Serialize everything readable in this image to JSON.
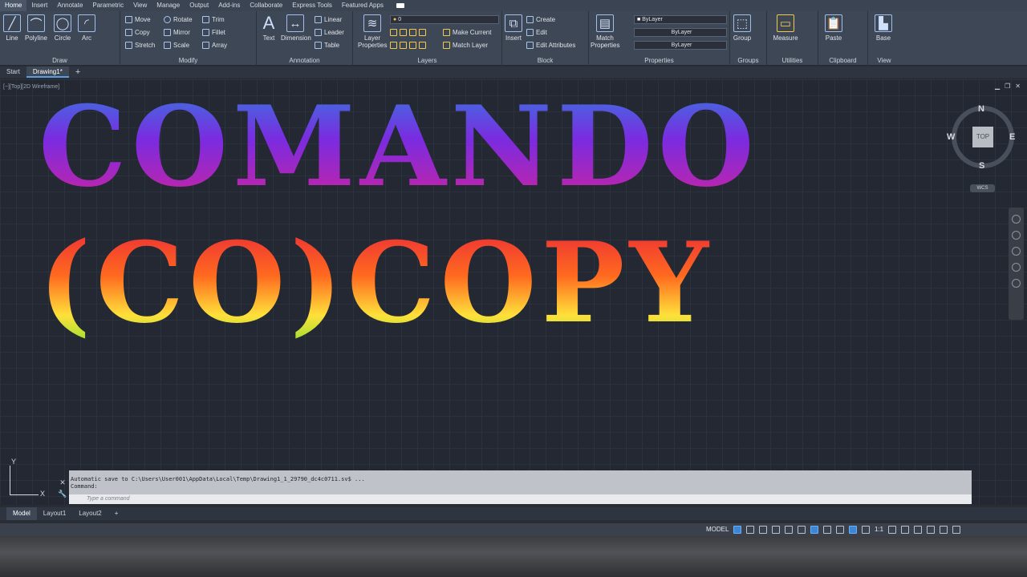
{
  "menu": {
    "tabs": [
      "Home",
      "Insert",
      "Annotate",
      "Parametric",
      "View",
      "Manage",
      "Output",
      "Add-ins",
      "Collaborate",
      "Express Tools",
      "Featured Apps"
    ],
    "active": "Home"
  },
  "ribbon": {
    "draw": {
      "title": "Draw",
      "line": "Line",
      "polyline": "Polyline",
      "circle": "Circle",
      "arc": "Arc"
    },
    "modify": {
      "title": "Modify",
      "move": "Move",
      "rotate": "Rotate",
      "trim": "Trim",
      "copy": "Copy",
      "mirror": "Mirror",
      "fillet": "Fillet",
      "stretch": "Stretch",
      "scale": "Scale",
      "array": "Array"
    },
    "annotation": {
      "title": "Annotation",
      "text": "Text",
      "dimension": "Dimension",
      "linear": "Linear",
      "leader": "Leader",
      "table": "Table"
    },
    "layers": {
      "title": "Layers",
      "layer_properties": "Layer Properties",
      "current_layer": "0",
      "make_current": "Make Current",
      "match_layer": "Match Layer"
    },
    "block": {
      "title": "Block",
      "insert": "Insert",
      "create": "Create",
      "edit": "Edit",
      "edit_attributes": "Edit Attributes"
    },
    "properties": {
      "title": "Properties",
      "match_properties": "Match Properties",
      "color": "ByLayer",
      "linetype": "ByLayer",
      "lineweight": "ByLayer"
    },
    "groups": {
      "title": "Groups",
      "group": "Group"
    },
    "utilities": {
      "title": "Utilities",
      "measure": "Measure"
    },
    "clipboard": {
      "title": "Clipboard",
      "paste": "Paste"
    },
    "view": {
      "title": "View",
      "base": "Base"
    }
  },
  "filetabs": [
    "Start",
    "Drawing1*",
    "+"
  ],
  "viewport": {
    "label": "[−][Top][2D Wireframe]",
    "line1": "COMANDO",
    "line2": "(CO)COPY"
  },
  "viewcube": {
    "face": "TOP",
    "n": "N",
    "s": "S",
    "e": "E",
    "w": "W",
    "wcs": "WCS"
  },
  "ucs": {
    "y": "Y",
    "x": "X"
  },
  "command": {
    "history1": "Automatic save to C:\\Users\\User001\\AppData\\Local\\Temp\\Drawing1_1_29790_dc4c0711.sv$ ...",
    "history2": "Command:",
    "placeholder": "Type a command"
  },
  "layouttabs": [
    "Model",
    "Layout1",
    "Layout2",
    "+"
  ],
  "status": {
    "model": "MODEL",
    "scale": "1:1"
  }
}
